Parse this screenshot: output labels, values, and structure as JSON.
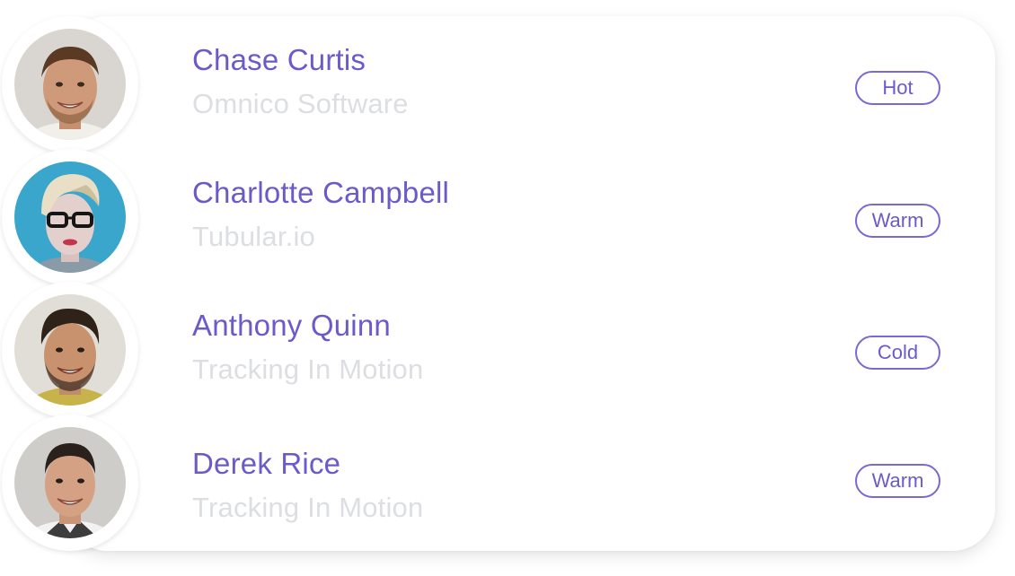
{
  "contacts": [
    {
      "name": "Chase Curtis",
      "company": "Omnico Software",
      "status": "Hot",
      "avatar": "man-smiling-photo"
    },
    {
      "name": "Charlotte Campbell",
      "company": "Tubular.io",
      "status": "Warm",
      "avatar": "woman-glasses-photo"
    },
    {
      "name": "Anthony Quinn",
      "company": "Tracking In Motion",
      "status": "Cold",
      "avatar": "man-beard-photo"
    },
    {
      "name": "Derek Rice",
      "company": "Tracking In Motion",
      "status": "Warm",
      "avatar": "man-suit-photo"
    }
  ],
  "colors": {
    "accent": "#6a5bc8",
    "badge_border": "#7a68d4",
    "company_text": "#dcdee2",
    "card_background": "#ffffff"
  }
}
